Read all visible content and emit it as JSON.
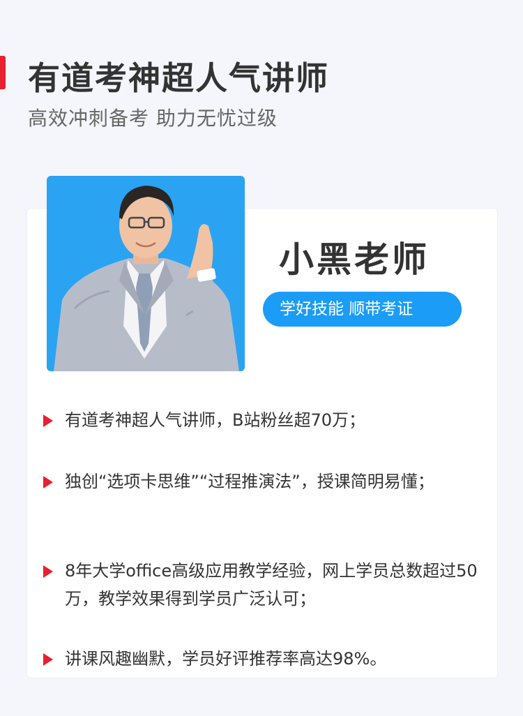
{
  "header": {
    "title": "有道考神超人气讲师",
    "subtitle": "高效冲刺备考 助力无忧过级",
    "accent_color": "#e8202f"
  },
  "teacher": {
    "name": "小黑老师",
    "slogan": "学好技能 顺带考证",
    "slogan_color": "#1a9cf7",
    "photo_background": "#2aa3f2"
  },
  "highlights": [
    {
      "text": "有道考神超人气讲师，B站粉丝超70万；"
    },
    {
      "text": "独创“选项卡思维”“过程推演法”，授课简明易懂；"
    },
    {
      "text": "8年大学office高级应用教学经验，网上学员总数超过50万，教学效果得到学员广泛认可；"
    },
    {
      "text": "讲课风趣幽默，学员好评推荐率高达98%。"
    }
  ]
}
